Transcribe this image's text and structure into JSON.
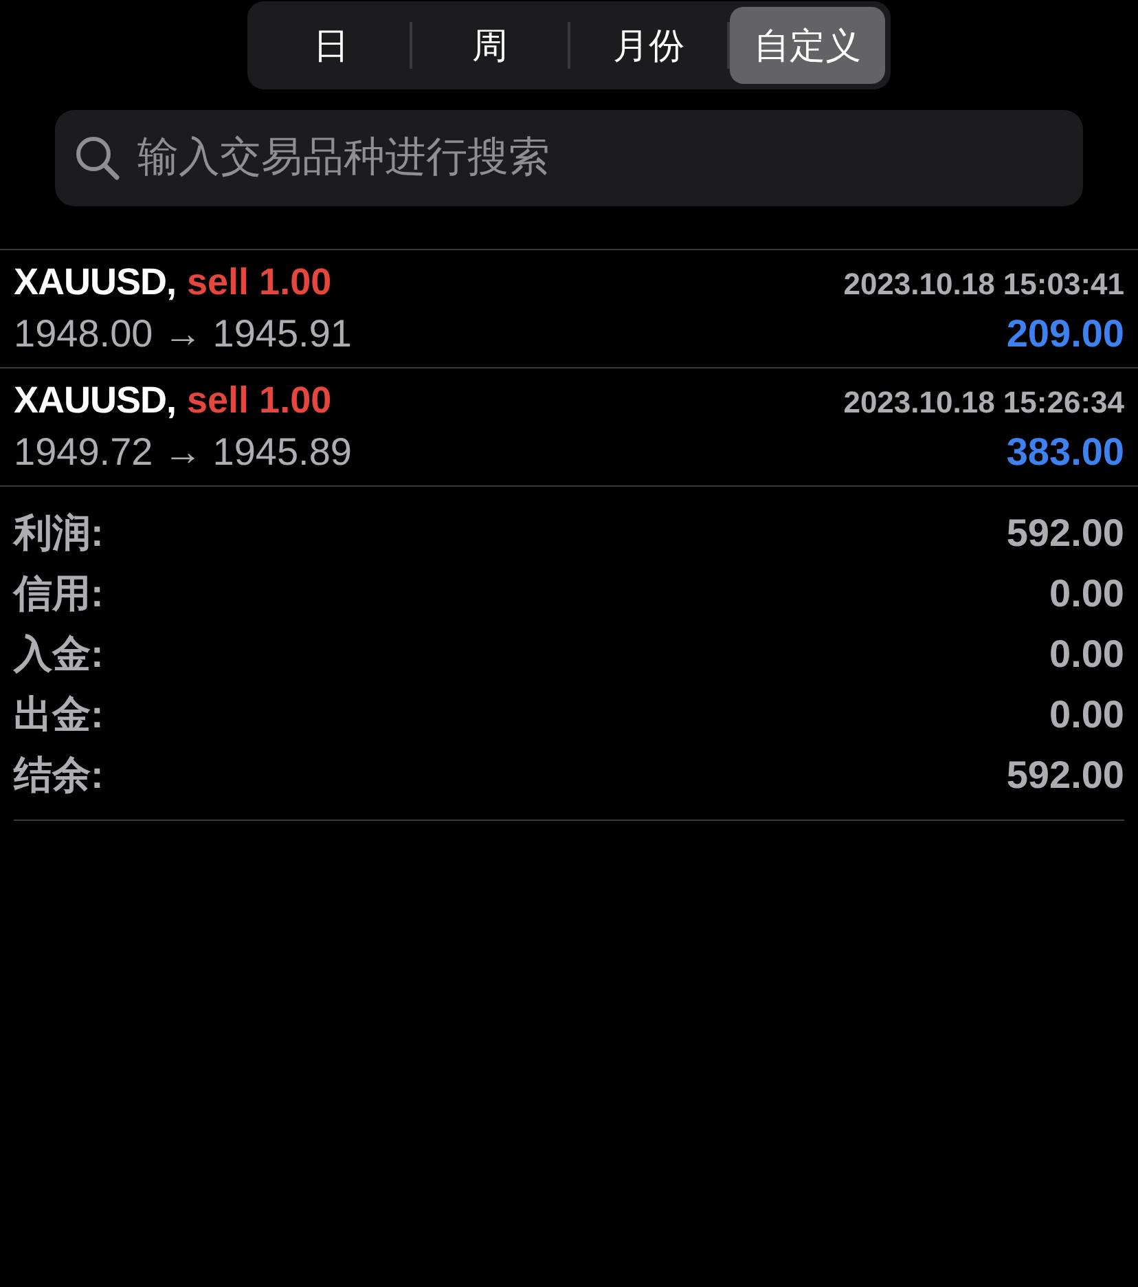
{
  "periods": [
    {
      "label": "日",
      "selected": false
    },
    {
      "label": "周",
      "selected": false
    },
    {
      "label": "月份",
      "selected": false
    },
    {
      "label": "自定义",
      "selected": true
    }
  ],
  "search": {
    "placeholder": "输入交易品种进行搜索"
  },
  "trades": [
    {
      "symbol": "XAUUSD,",
      "side": "sell",
      "quantity": "1.00",
      "time": "2023.10.18 15:03:41",
      "prices": "1948.00 → 1945.91",
      "profit": "209.00"
    },
    {
      "symbol": "XAUUSD,",
      "side": "sell",
      "quantity": "1.00",
      "time": "2023.10.18 15:26:34",
      "prices": "1949.72 → 1945.89",
      "profit": "383.00"
    }
  ],
  "summary": [
    {
      "label": "利润:",
      "value": "592.00"
    },
    {
      "label": "信用:",
      "value": "0.00"
    },
    {
      "label": "入金:",
      "value": "0.00"
    },
    {
      "label": "出金:",
      "value": "0.00"
    },
    {
      "label": "结余:",
      "value": "592.00"
    }
  ]
}
